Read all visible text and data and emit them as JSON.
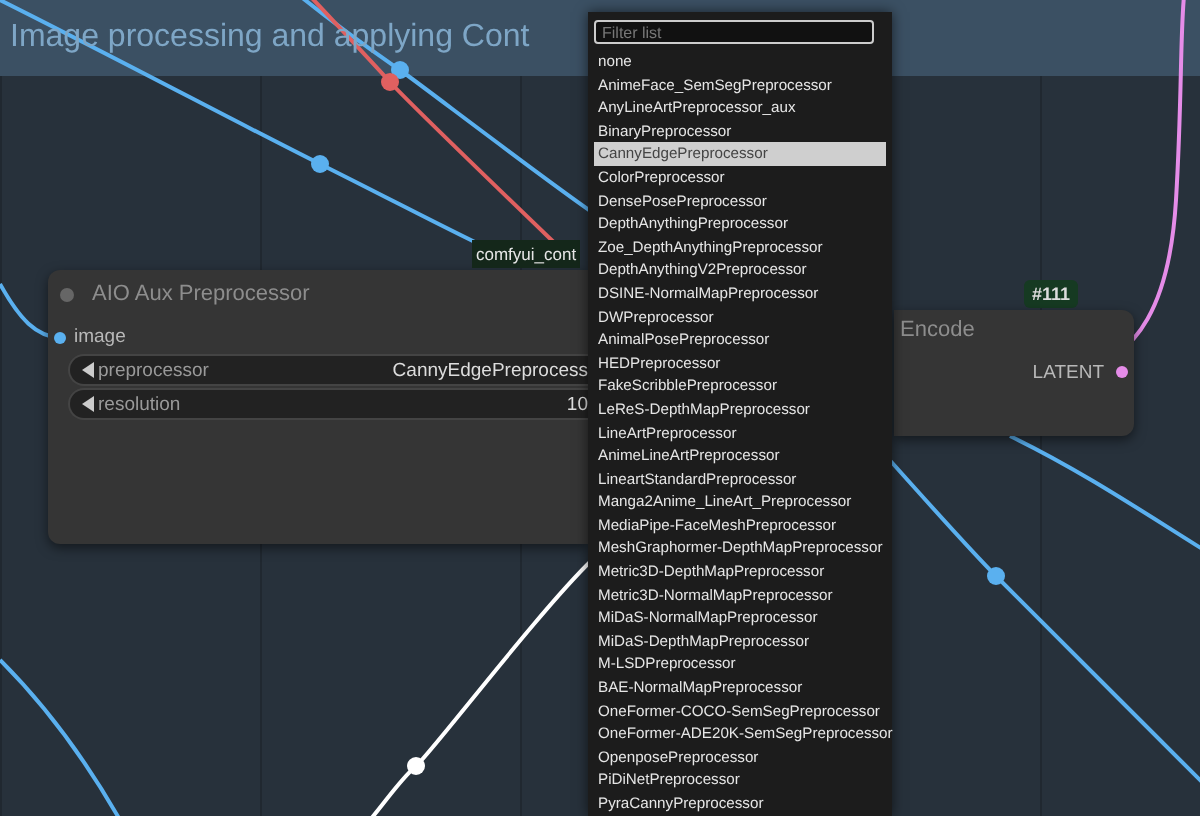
{
  "group": {
    "title": "Image processing and applying Cont"
  },
  "nodes": [
    {
      "kind": "preprocessor",
      "title": "AIO Aux Preprocessor",
      "inputs": [
        "image"
      ],
      "widgets": [
        {
          "label": "preprocessor",
          "value": "CannyEdgePreprocess"
        },
        {
          "label": "resolution",
          "value": "10"
        }
      ]
    },
    {
      "kind": "encode",
      "title": "Encode",
      "badge": "#111",
      "outputs": [
        "LATENT"
      ]
    }
  ],
  "tooltip": "comfyui_cont",
  "dropdown": {
    "placeholder": "Filter list",
    "items": [
      {
        "label": "none",
        "selected": false
      },
      {
        "label": "AnimeFace_SemSegPreprocessor",
        "selected": false
      },
      {
        "label": "AnyLineArtPreprocessor_aux",
        "selected": false
      },
      {
        "label": "BinaryPreprocessor",
        "selected": false
      },
      {
        "label": "CannyEdgePreprocessor",
        "selected": true
      },
      {
        "label": "ColorPreprocessor",
        "selected": false
      },
      {
        "label": "DensePosePreprocessor",
        "selected": false
      },
      {
        "label": "DepthAnythingPreprocessor",
        "selected": false
      },
      {
        "label": "Zoe_DepthAnythingPreprocessor",
        "selected": false
      },
      {
        "label": "DepthAnythingV2Preprocessor",
        "selected": false
      },
      {
        "label": "DSINE-NormalMapPreprocessor",
        "selected": false
      },
      {
        "label": "DWPreprocessor",
        "selected": false
      },
      {
        "label": "AnimalPosePreprocessor",
        "selected": false
      },
      {
        "label": "HEDPreprocessor",
        "selected": false
      },
      {
        "label": "FakeScribblePreprocessor",
        "selected": false
      },
      {
        "label": "LeReS-DepthMapPreprocessor",
        "selected": false
      },
      {
        "label": "LineArtPreprocessor",
        "selected": false
      },
      {
        "label": "AnimeLineArtPreprocessor",
        "selected": false
      },
      {
        "label": "LineartStandardPreprocessor",
        "selected": false
      },
      {
        "label": "Manga2Anime_LineArt_Preprocessor",
        "selected": false
      },
      {
        "label": "MediaPipe-FaceMeshPreprocessor",
        "selected": false
      },
      {
        "label": "MeshGraphormer-DepthMapPreprocessor",
        "selected": false
      },
      {
        "label": "Metric3D-DepthMapPreprocessor",
        "selected": false
      },
      {
        "label": "Metric3D-NormalMapPreprocessor",
        "selected": false
      },
      {
        "label": "MiDaS-NormalMapPreprocessor",
        "selected": false
      },
      {
        "label": "MiDaS-DepthMapPreprocessor",
        "selected": false
      },
      {
        "label": "M-LSDPreprocessor",
        "selected": false
      },
      {
        "label": "BAE-NormalMapPreprocessor",
        "selected": false
      },
      {
        "label": "OneFormer-COCO-SemSegPreprocessor",
        "selected": false
      },
      {
        "label": "OneFormer-ADE20K-SemSegPreprocessor",
        "selected": false
      },
      {
        "label": "OpenposePreprocessor",
        "selected": false
      },
      {
        "label": "PiDiNetPreprocessor",
        "selected": false
      },
      {
        "label": "PyraCannyPreprocessor",
        "selected": false
      }
    ]
  }
}
